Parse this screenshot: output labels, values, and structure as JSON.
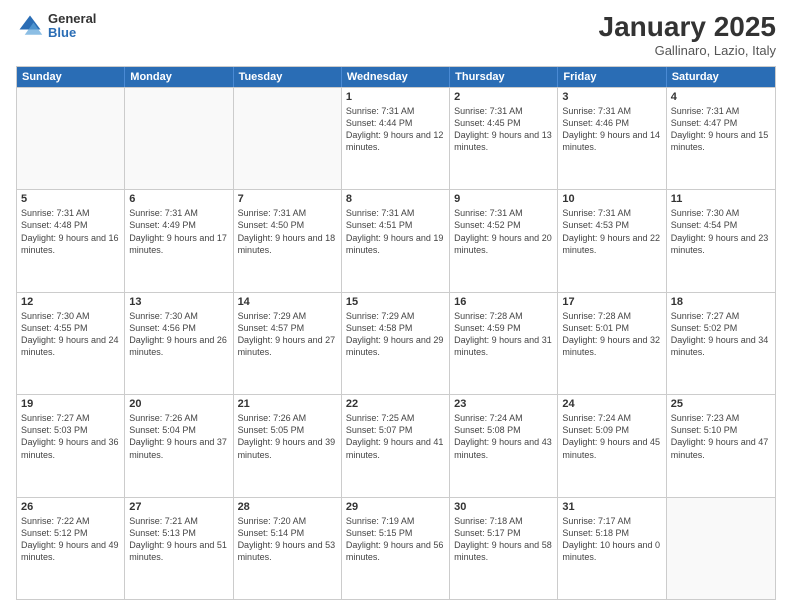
{
  "logo": {
    "general": "General",
    "blue": "Blue"
  },
  "header": {
    "month": "January 2025",
    "location": "Gallinaro, Lazio, Italy"
  },
  "weekdays": [
    "Sunday",
    "Monday",
    "Tuesday",
    "Wednesday",
    "Thursday",
    "Friday",
    "Saturday"
  ],
  "weeks": [
    [
      {
        "day": "",
        "empty": true
      },
      {
        "day": "",
        "empty": true
      },
      {
        "day": "",
        "empty": true
      },
      {
        "day": "1",
        "sunrise": "7:31 AM",
        "sunset": "4:44 PM",
        "daylight": "9 hours and 12 minutes."
      },
      {
        "day": "2",
        "sunrise": "7:31 AM",
        "sunset": "4:45 PM",
        "daylight": "9 hours and 13 minutes."
      },
      {
        "day": "3",
        "sunrise": "7:31 AM",
        "sunset": "4:46 PM",
        "daylight": "9 hours and 14 minutes."
      },
      {
        "day": "4",
        "sunrise": "7:31 AM",
        "sunset": "4:47 PM",
        "daylight": "9 hours and 15 minutes."
      }
    ],
    [
      {
        "day": "5",
        "sunrise": "7:31 AM",
        "sunset": "4:48 PM",
        "daylight": "9 hours and 16 minutes."
      },
      {
        "day": "6",
        "sunrise": "7:31 AM",
        "sunset": "4:49 PM",
        "daylight": "9 hours and 17 minutes."
      },
      {
        "day": "7",
        "sunrise": "7:31 AM",
        "sunset": "4:50 PM",
        "daylight": "9 hours and 18 minutes."
      },
      {
        "day": "8",
        "sunrise": "7:31 AM",
        "sunset": "4:51 PM",
        "daylight": "9 hours and 19 minutes."
      },
      {
        "day": "9",
        "sunrise": "7:31 AM",
        "sunset": "4:52 PM",
        "daylight": "9 hours and 20 minutes."
      },
      {
        "day": "10",
        "sunrise": "7:31 AM",
        "sunset": "4:53 PM",
        "daylight": "9 hours and 22 minutes."
      },
      {
        "day": "11",
        "sunrise": "7:30 AM",
        "sunset": "4:54 PM",
        "daylight": "9 hours and 23 minutes."
      }
    ],
    [
      {
        "day": "12",
        "sunrise": "7:30 AM",
        "sunset": "4:55 PM",
        "daylight": "9 hours and 24 minutes."
      },
      {
        "day": "13",
        "sunrise": "7:30 AM",
        "sunset": "4:56 PM",
        "daylight": "9 hours and 26 minutes."
      },
      {
        "day": "14",
        "sunrise": "7:29 AM",
        "sunset": "4:57 PM",
        "daylight": "9 hours and 27 minutes."
      },
      {
        "day": "15",
        "sunrise": "7:29 AM",
        "sunset": "4:58 PM",
        "daylight": "9 hours and 29 minutes."
      },
      {
        "day": "16",
        "sunrise": "7:28 AM",
        "sunset": "4:59 PM",
        "daylight": "9 hours and 31 minutes."
      },
      {
        "day": "17",
        "sunrise": "7:28 AM",
        "sunset": "5:01 PM",
        "daylight": "9 hours and 32 minutes."
      },
      {
        "day": "18",
        "sunrise": "7:27 AM",
        "sunset": "5:02 PM",
        "daylight": "9 hours and 34 minutes."
      }
    ],
    [
      {
        "day": "19",
        "sunrise": "7:27 AM",
        "sunset": "5:03 PM",
        "daylight": "9 hours and 36 minutes."
      },
      {
        "day": "20",
        "sunrise": "7:26 AM",
        "sunset": "5:04 PM",
        "daylight": "9 hours and 37 minutes."
      },
      {
        "day": "21",
        "sunrise": "7:26 AM",
        "sunset": "5:05 PM",
        "daylight": "9 hours and 39 minutes."
      },
      {
        "day": "22",
        "sunrise": "7:25 AM",
        "sunset": "5:07 PM",
        "daylight": "9 hours and 41 minutes."
      },
      {
        "day": "23",
        "sunrise": "7:24 AM",
        "sunset": "5:08 PM",
        "daylight": "9 hours and 43 minutes."
      },
      {
        "day": "24",
        "sunrise": "7:24 AM",
        "sunset": "5:09 PM",
        "daylight": "9 hours and 45 minutes."
      },
      {
        "day": "25",
        "sunrise": "7:23 AM",
        "sunset": "5:10 PM",
        "daylight": "9 hours and 47 minutes."
      }
    ],
    [
      {
        "day": "26",
        "sunrise": "7:22 AM",
        "sunset": "5:12 PM",
        "daylight": "9 hours and 49 minutes."
      },
      {
        "day": "27",
        "sunrise": "7:21 AM",
        "sunset": "5:13 PM",
        "daylight": "9 hours and 51 minutes."
      },
      {
        "day": "28",
        "sunrise": "7:20 AM",
        "sunset": "5:14 PM",
        "daylight": "9 hours and 53 minutes."
      },
      {
        "day": "29",
        "sunrise": "7:19 AM",
        "sunset": "5:15 PM",
        "daylight": "9 hours and 56 minutes."
      },
      {
        "day": "30",
        "sunrise": "7:18 AM",
        "sunset": "5:17 PM",
        "daylight": "9 hours and 58 minutes."
      },
      {
        "day": "31",
        "sunrise": "7:17 AM",
        "sunset": "5:18 PM",
        "daylight": "10 hours and 0 minutes."
      },
      {
        "day": "",
        "empty": true
      }
    ]
  ]
}
